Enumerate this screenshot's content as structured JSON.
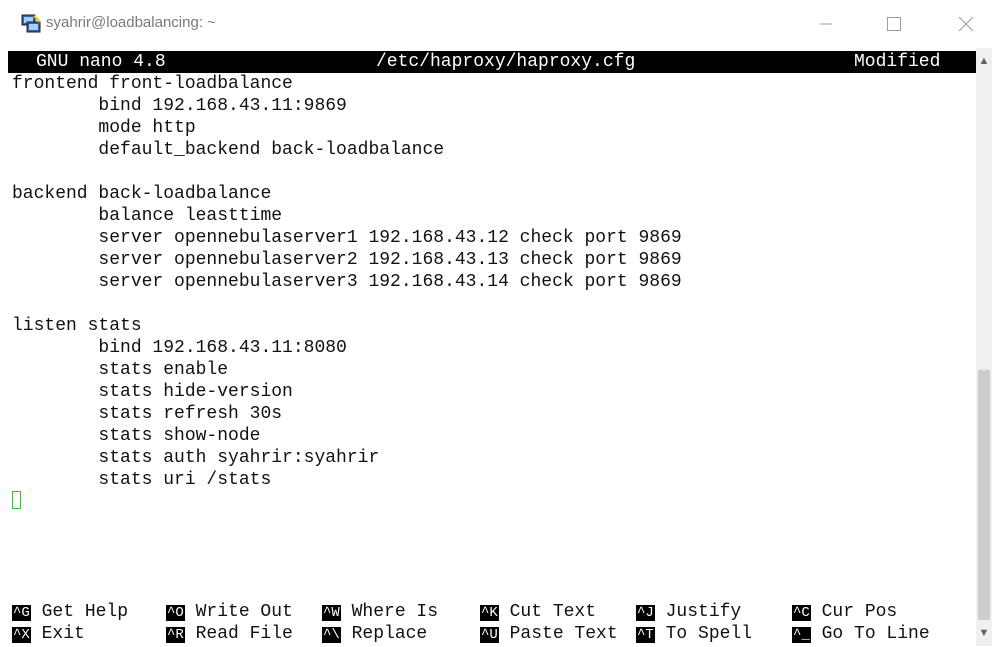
{
  "window": {
    "title": "syahrir@loadbalancing: ~",
    "icons": {
      "app": "putty-icon",
      "minimize": "minimize-icon",
      "maximize": "maximize-icon",
      "close": "close-icon"
    }
  },
  "nano": {
    "app": "GNU nano 4.8",
    "file": "/etc/haproxy/haproxy.cfg",
    "status": "Modified"
  },
  "buffer": {
    "lines": [
      "frontend front-loadbalance",
      "        bind 192.168.43.11:9869",
      "        mode http",
      "        default_backend back-loadbalance",
      "",
      "backend back-loadbalance",
      "        balance leasttime",
      "        server opennebulaserver1 192.168.43.12 check port 9869",
      "        server opennebulaserver2 192.168.43.13 check port 9869",
      "        server opennebulaserver3 192.168.43.14 check port 9869",
      "",
      "listen stats",
      "        bind 192.168.43.11:8080",
      "        stats enable",
      "        stats hide-version",
      "        stats refresh 30s",
      "        stats show-node",
      "        stats auth syahrir:syahrir",
      "        stats uri /stats"
    ]
  },
  "shortcuts": [
    {
      "key": "^G",
      "label": "Get Help"
    },
    {
      "key": "^O",
      "label": "Write Out"
    },
    {
      "key": "^W",
      "label": "Where Is"
    },
    {
      "key": "^K",
      "label": "Cut Text"
    },
    {
      "key": "^J",
      "label": "Justify"
    },
    {
      "key": "^C",
      "label": "Cur Pos"
    },
    {
      "key": "^X",
      "label": "Exit"
    },
    {
      "key": "^R",
      "label": "Read File"
    },
    {
      "key": "^\\",
      "label": "Replace"
    },
    {
      "key": "^U",
      "label": "Paste Text"
    },
    {
      "key": "^T",
      "label": "To Spell"
    },
    {
      "key": "^_",
      "label": "Go To Line"
    }
  ],
  "colors": {
    "cursor": "#22cc22",
    "header_bg": "#000000"
  }
}
